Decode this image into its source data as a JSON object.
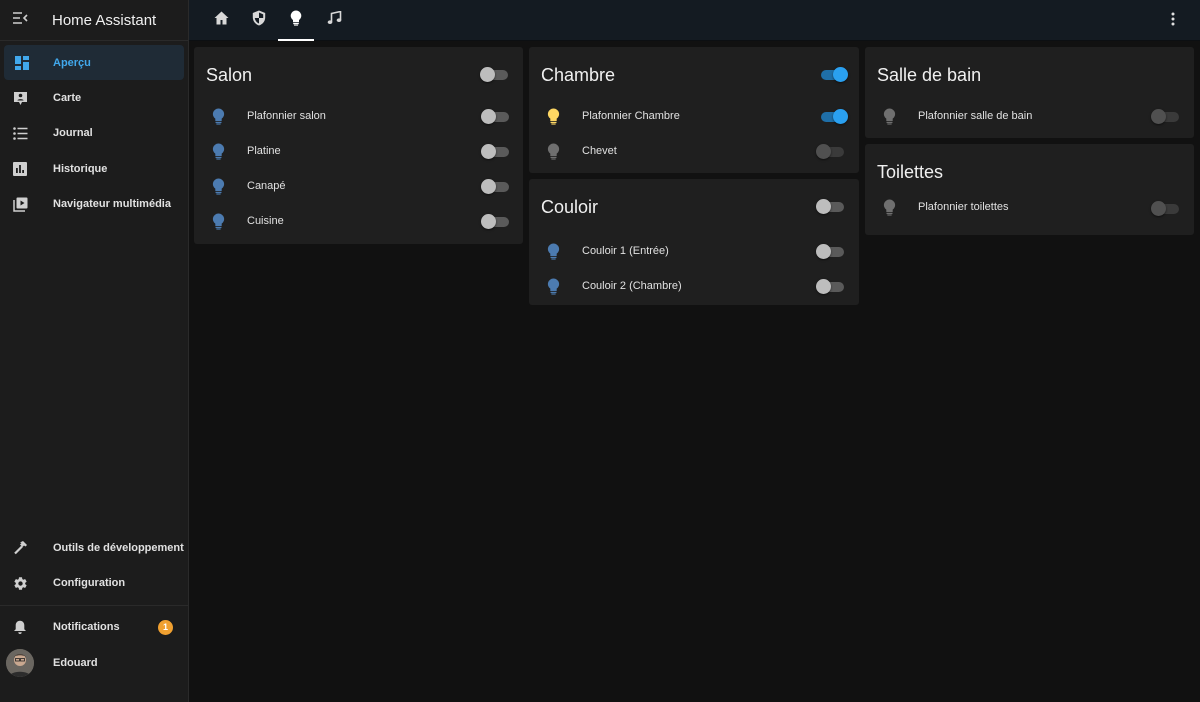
{
  "app": {
    "title": "Home Assistant"
  },
  "sidebar": {
    "items": [
      {
        "label": "Aperçu"
      },
      {
        "label": "Carte"
      },
      {
        "label": "Journal"
      },
      {
        "label": "Historique"
      },
      {
        "label": "Navigateur multimédia"
      }
    ],
    "bottom_items": [
      {
        "label": "Outils de développement"
      },
      {
        "label": "Configuration"
      }
    ],
    "notifications": {
      "label": "Notifications",
      "count": "1"
    },
    "user": {
      "name": "Edouard"
    }
  },
  "tabs": [
    "home-icon",
    "shield-icon",
    "lightbulb-icon",
    "music-icon"
  ],
  "colors": {
    "accent": "#41a8ec",
    "bulb_on": "#fdd663",
    "bulb_off": "#4c7bb0",
    "bulb_unavailable": "#6f6f6f",
    "badge": "#f0a030"
  },
  "cards": {
    "salon": {
      "title": "Salon",
      "header_on": false,
      "entities": [
        {
          "name": "Plafonnier salon",
          "on": false
        },
        {
          "name": "Platine",
          "on": false
        },
        {
          "name": "Canapé",
          "on": false
        },
        {
          "name": "Cuisine",
          "on": false
        }
      ]
    },
    "chambre": {
      "title": "Chambre",
      "header_on": true,
      "entities": [
        {
          "name": "Plafonnier Chambre",
          "on": true
        },
        {
          "name": "Chevet",
          "on": false,
          "unavailable": true
        }
      ]
    },
    "couloir": {
      "title": "Couloir",
      "header_on": false,
      "entities": [
        {
          "name": "Couloir 1 (Entrée)",
          "on": false
        },
        {
          "name": "Couloir 2 (Chambre)",
          "on": false
        }
      ]
    },
    "salle_de_bain": {
      "title": "Salle de bain",
      "entities": [
        {
          "name": "Plafonnier salle de bain",
          "on": false,
          "unavailable": true
        }
      ]
    },
    "toilettes": {
      "title": "Toilettes",
      "entities": [
        {
          "name": "Plafonnier toilettes",
          "on": false,
          "unavailable": true
        }
      ]
    }
  }
}
